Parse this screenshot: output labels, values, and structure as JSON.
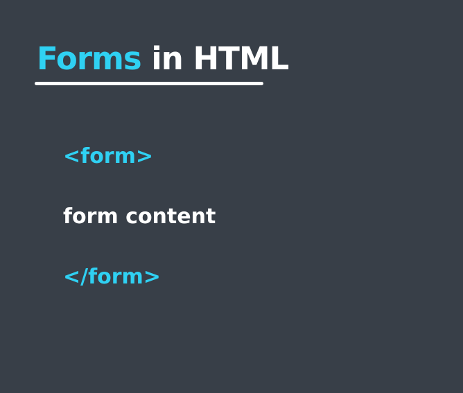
{
  "slide": {
    "title_accent": "Forms",
    "title_rest": " in HTML",
    "lines": {
      "open_tag": "<form>",
      "content": "form content",
      "close_tag": "</form>"
    }
  },
  "colors": {
    "background": "#383f48",
    "accent": "#2fd1f3",
    "text": "#ffffff"
  }
}
